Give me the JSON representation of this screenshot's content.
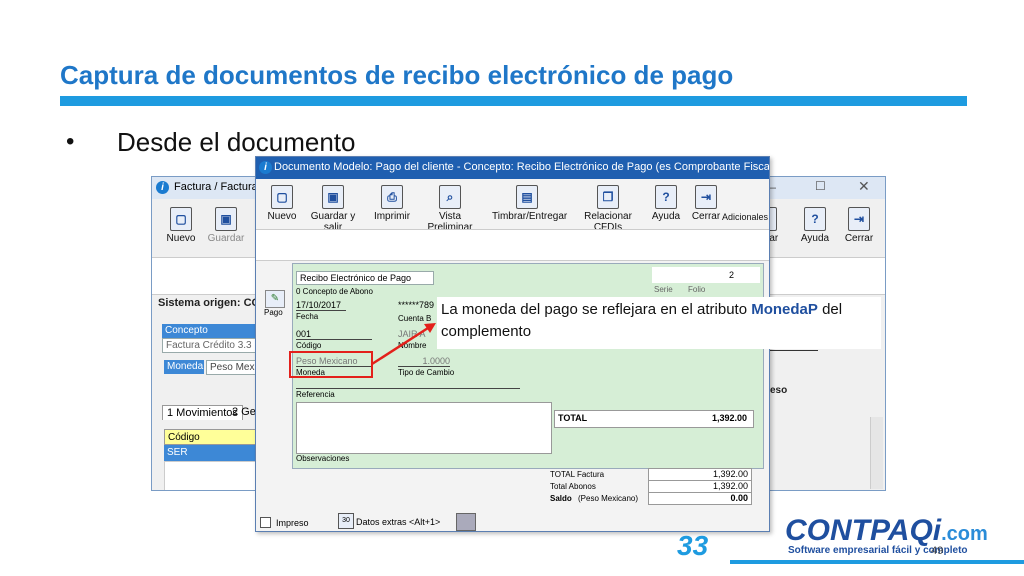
{
  "slide": {
    "title": "Captura de documentos de recibo electrónico de pago",
    "bullet_symbol": "•",
    "bullet_text": "Desde el documento",
    "page_number": "49"
  },
  "back_window": {
    "title": "Factura / Factura",
    "toolbar": [
      {
        "label": "Nuevo",
        "icon": "new-document-icon"
      },
      {
        "label": "Guardar",
        "icon": "save-icon"
      },
      {
        "label": "dar",
        "icon": "save-icon"
      },
      {
        "label": "Ayuda",
        "icon": "help-icon"
      },
      {
        "label": "Cerrar",
        "icon": "exit-icon"
      }
    ],
    "sistema_origen": "Sistema origen: CO",
    "concepto_label": "Concepto",
    "concepto_value": "Factura Crédito 3.3",
    "moneda_label": "Moneda",
    "moneda_value": "Peso Mexi",
    "tabs": [
      "1 Movimientos",
      "2 Ge"
    ],
    "grid_header": "Código",
    "grid_row": "SER",
    "right_label": "eso"
  },
  "front_window": {
    "title": "Documento Modelo: Pago del cliente - Concepto: Recibo Electrónico de Pago (es Comprobante Fiscal Digital ...",
    "toolbar": [
      {
        "label": "Nuevo",
        "icon": "new-document-icon"
      },
      {
        "label": "Guardar y salir",
        "icon": "save-icon"
      },
      {
        "label": "Imprimir",
        "icon": "print-icon"
      },
      {
        "label": "Vista Preliminar",
        "icon": "preview-icon"
      },
      {
        "label": "Timbrar/Entregar",
        "icon": "stamp-icon"
      },
      {
        "label": "Relacionar CFDIs",
        "icon": "relate-icon"
      },
      {
        "label": "Ayuda",
        "icon": "help-icon"
      },
      {
        "label": "Cerrar",
        "icon": "exit-icon"
      }
    ],
    "adicionales": "Adicionales",
    "side_label": "Pago",
    "concepto_value": "Recibo Electrónico de Pago",
    "concepto_label": "0 Concepto de Abono",
    "serie_label": "Serie",
    "folio_label": "Folio",
    "folio_value": "2",
    "fecha_value": "17/10/2017",
    "fecha_label": "Fecha",
    "cuenta_value": "******789",
    "cuenta_label": "Cuenta B",
    "codigo_value": "001",
    "codigo_label": "Código",
    "nombre_value": "JAIR A",
    "nombre_label": "Nombre",
    "moneda_value": "Peso Mexicano",
    "moneda_label": "Moneda",
    "tipo_cambio_value": "1.0000",
    "tipo_cambio_label": "Tipo de Cambio",
    "referencia_label": "Referencia",
    "observaciones_label": "Observaciones",
    "total_label": "TOTAL",
    "total_value": "1,392.00",
    "total_factura_label": "TOTAL Factura",
    "total_factura_value": "1,392.00",
    "total_abonos_label": "Total Abonos",
    "total_abonos_value": "1,392.00",
    "saldo_label": "Saldo",
    "saldo_currency": "(Peso Mexicano)",
    "saldo_value": "0.00",
    "impreso_label": "Impreso",
    "datos_extras": "Datos extras <Alt+1>"
  },
  "callout": {
    "text_before": "La moneda del pago se reflejara en el atributo ",
    "highlight": "MonedaP",
    "text_after": " del complemento"
  },
  "logo": {
    "brand": "CONTPAQi",
    "suffix": ".com",
    "tagline": "Software empresarial fácil y completo",
    "anniversary": "33"
  },
  "colors": {
    "title": "#1f77c8",
    "accent": "#1e9be0",
    "highlight_box": "#e3201b",
    "form_bg": "#d6eed6"
  }
}
